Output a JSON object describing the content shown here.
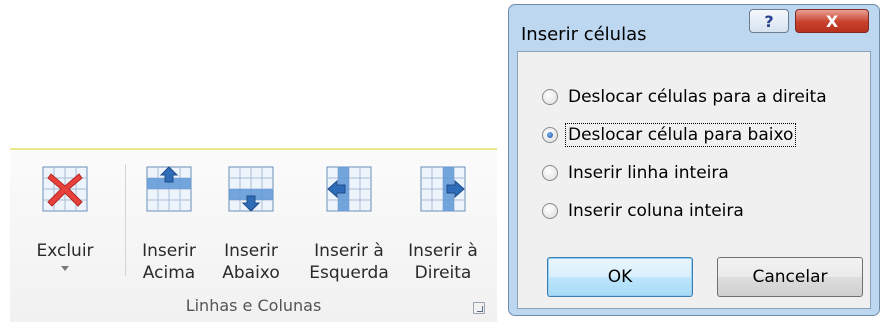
{
  "ribbon": {
    "buttons": [
      {
        "label": "Excluir",
        "icon": "delete-cells-icon"
      },
      {
        "label": "Inserir\nAcima",
        "icon": "insert-row-above-icon"
      },
      {
        "label": "Inserir\nAbaixo",
        "icon": "insert-row-below-icon"
      },
      {
        "label": "Inserir à\nEsquerda",
        "icon": "insert-column-left-icon"
      },
      {
        "label": "Inserir à\nDireita",
        "icon": "insert-column-right-icon"
      }
    ],
    "group_label": "Linhas e Colunas"
  },
  "dialog": {
    "title": "Inserir células",
    "help_glyph": "?",
    "close_glyph": "X",
    "options": [
      {
        "label": "Deslocar células para a direita",
        "checked": false
      },
      {
        "label": "Deslocar célula para baixo",
        "checked": true
      },
      {
        "label": "Inserir linha inteira",
        "checked": false
      },
      {
        "label": "Inserir coluna inteira",
        "checked": false
      }
    ],
    "ok_label": "OK",
    "cancel_label": "Cancelar"
  },
  "colors": {
    "delete_x": "#e8413b",
    "grid_blue": "#3b7bc8",
    "dialog_frame": "#bdd7f0",
    "close_red": "#c7412c"
  }
}
